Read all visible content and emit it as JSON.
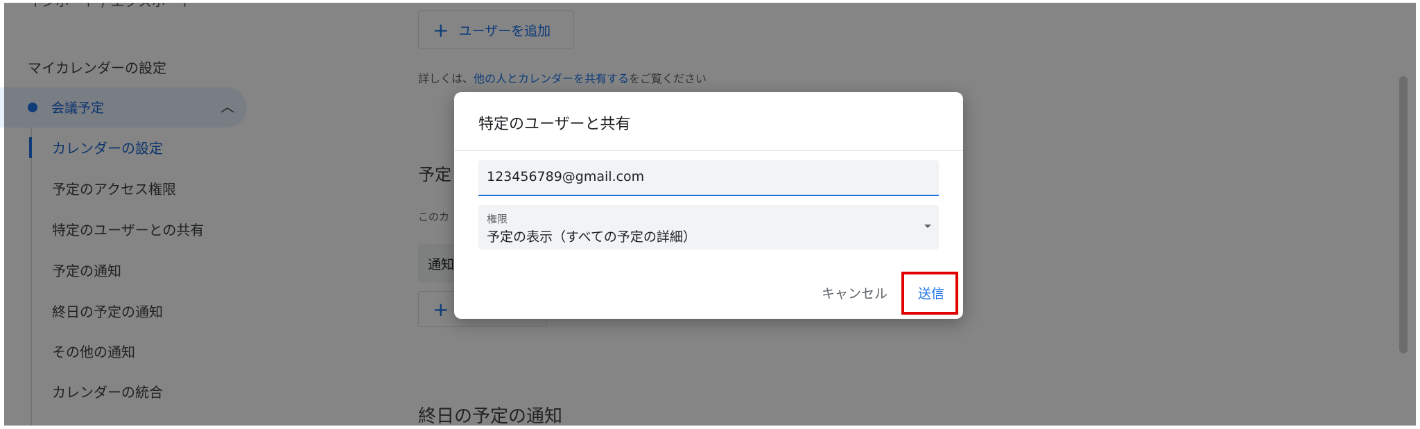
{
  "sidebar": {
    "cut_text": "インポート / エクスポート",
    "heading": "マイカレンダーの設定",
    "calendar": {
      "name": "会議予定",
      "color": "#1a73e8",
      "expanded_glyph": "︿"
    },
    "items": [
      {
        "label": "カレンダーの設定",
        "active": true
      },
      {
        "label": "予定のアクセス権限"
      },
      {
        "label": "特定のユーザーとの共有"
      },
      {
        "label": "予定の通知"
      },
      {
        "label": "終日の予定の通知"
      },
      {
        "label": "その他の通知"
      },
      {
        "label": "カレンダーの統合"
      }
    ]
  },
  "main": {
    "add_user_label": "ユーザーを追加",
    "help": {
      "prefix": "詳しくは、",
      "link": "他の人とカレンダーを共有する",
      "suffix": "をご覧ください"
    },
    "section_title_cut": "予定",
    "desc_cut": "このカ",
    "notif_label_cut": "通知",
    "allday_title": "終日の予定の通知"
  },
  "dialog": {
    "title": "特定のユーザーと共有",
    "email_value": "123456789@gmail.com",
    "permission_label": "権限",
    "permission_value": "予定の表示（すべての予定の詳細）",
    "cancel_label": "キャンセル",
    "send_label": "送信",
    "highlight_color": "#e00000"
  },
  "icons": {
    "plus": "+"
  },
  "colors": {
    "accent": "#1a73e8",
    "overlay": "rgba(0,0,0,0.48)"
  }
}
